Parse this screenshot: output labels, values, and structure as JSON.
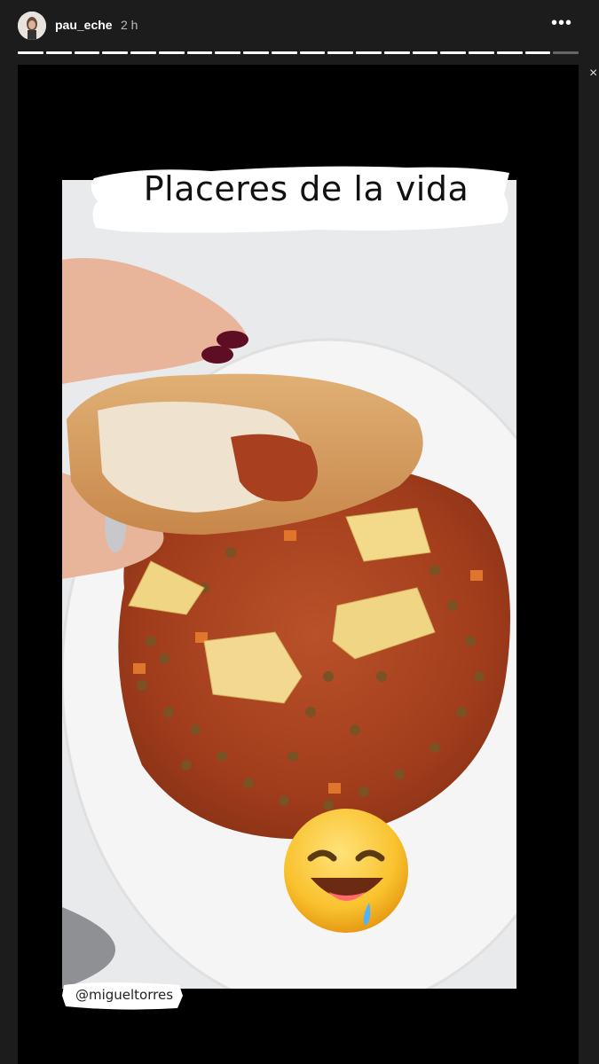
{
  "header": {
    "username": "pau_eche",
    "time": "2 h",
    "more_icon": "more-horizontal-icon"
  },
  "progress": {
    "segments_total": 20,
    "segment_current": 19
  },
  "story": {
    "caption": "Placeres de la vida",
    "mention": "@migueltorres",
    "emoji": "drooling-smiling-face",
    "colors": {
      "plate": "#f3f3f3",
      "stew": "#a8401f",
      "lentil": "#6e4a1f",
      "potato": "#f0d585",
      "bread": "#d9a060"
    }
  },
  "side": {
    "close_glyph": "×"
  }
}
